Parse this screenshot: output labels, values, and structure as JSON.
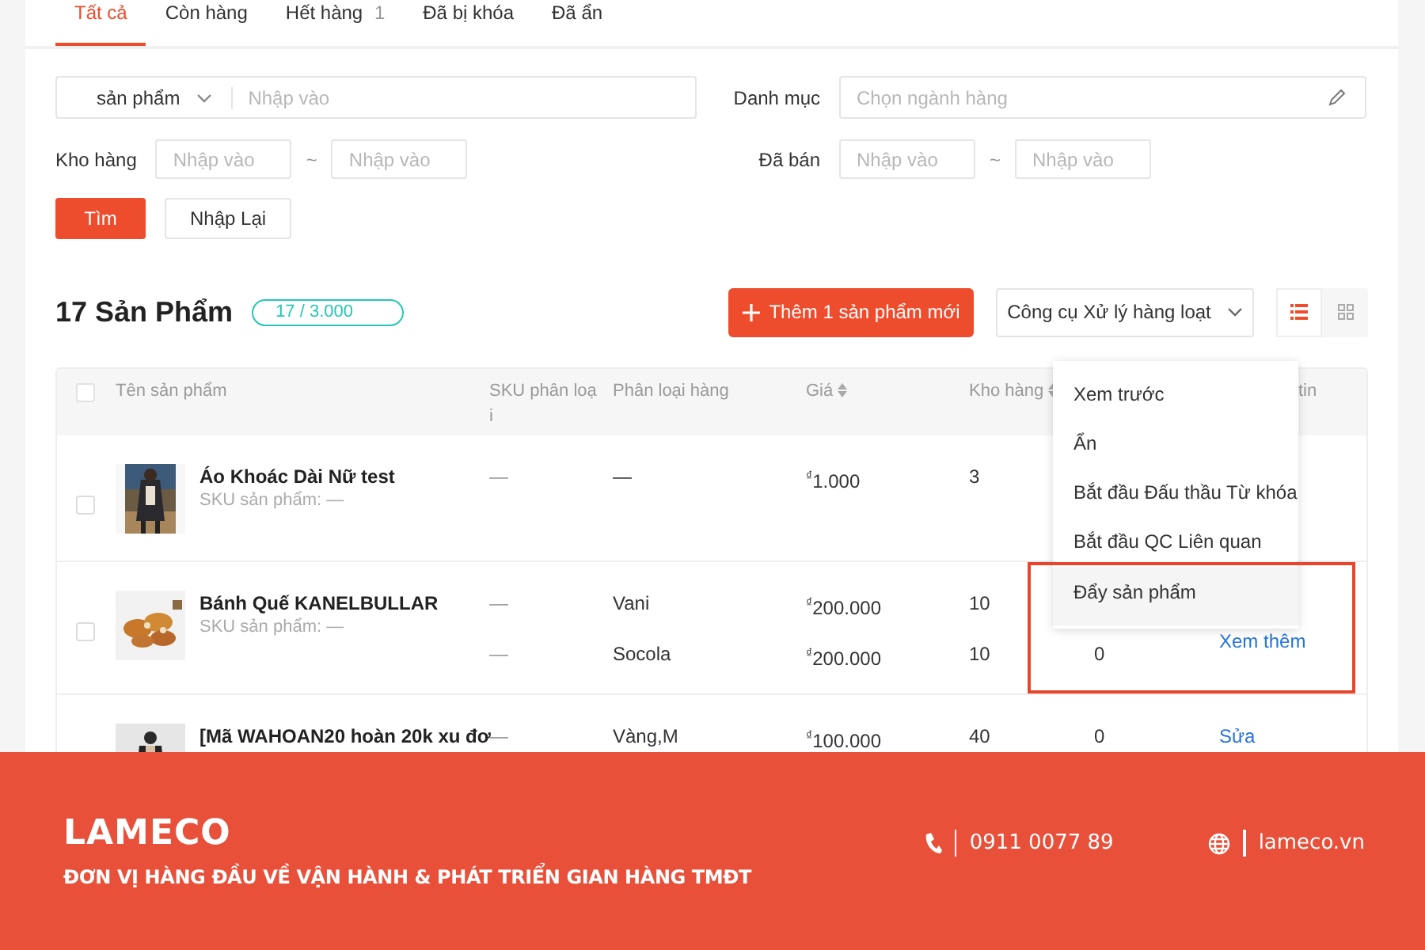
{
  "tabs": [
    {
      "label": "Tất cả",
      "selected": true
    },
    {
      "label": "Còn hàng",
      "selected": false
    },
    {
      "label": "Hết hàng",
      "count": "1",
      "selected": false
    },
    {
      "label": "Đã bị khóa",
      "selected": false
    },
    {
      "label": "Đã ẩn",
      "selected": false
    }
  ],
  "filters": {
    "product": {
      "select_label": "sản phẩm",
      "placeholder": "Nhập vào"
    },
    "category": {
      "label": "Danh mục",
      "placeholder": "Chọn ngành hàng"
    },
    "stock": {
      "label": "Kho hàng",
      "from_placeholder": "Nhập vào",
      "separator": "~",
      "to_placeholder": "Nhập vào"
    },
    "sold": {
      "label": "Đã bán",
      "from_placeholder": "Nhập vào",
      "separator": "~",
      "to_placeholder": "Nhập vào"
    },
    "search_button": "Tìm",
    "reset_button": "Nhập Lại"
  },
  "toolbar": {
    "title": "17 Sản Phẩm",
    "quota": "17 / 3.000",
    "add_button": "Thêm 1 sản phẩm mới",
    "bulk_tool": "Công cụ Xử lý hàng loạt",
    "view_modes": [
      {
        "kind": "list",
        "selected": true
      },
      {
        "kind": "grid",
        "selected": false
      }
    ]
  },
  "table": {
    "select_all_checked": false,
    "columns": [
      {
        "label": "Tên sản phẩm",
        "sortable": false
      },
      {
        "label": "SKU phân loại",
        "sortable": false
      },
      {
        "label": "Phân loại hàng",
        "sortable": false
      },
      {
        "label": "Giá",
        "sortable": true
      },
      {
        "label": "Kho hàng",
        "sortable": true
      },
      {
        "label": "tin",
        "sortable": false
      }
    ],
    "rows": [
      {
        "checked": false,
        "image": {
          "kind": "picture"
        },
        "name": "Áo Khoác Dài Nữ test",
        "sku": "SKU sản phẩm: —",
        "variants": [
          {
            "sku": "—",
            "variant": "—",
            "price": "$^{₫}$1.000",
            "stock": "3"
          }
        ]
      },
      {
        "checked": false,
        "image": {
          "kind": "picture"
        },
        "name": "Bánh Quế KANELBULLAR",
        "sku": "SKU sản phẩm: —",
        "variants": [
          {
            "sku": "—",
            "variant": "Vani",
            "price": "$^{₫}$200.000",
            "stock": "10"
          },
          {
            "sku": "—",
            "variant": "Socola",
            "price": "$^{₫}$200.000",
            "stock": "10",
            "sales": "0"
          }
        ],
        "actions": [
          "Xem thêm"
        ]
      },
      {
        "image": {
          "kind": "picture"
        },
        "name": "[Mã WAHOAN20 hoàn 20k xu đơ",
        "variants": [
          {
            "sku": "—",
            "variant": "Vàng,M",
            "price": "$^{₫}$100.000",
            "stock": "40",
            "sales": "0"
          }
        ],
        "actions": [
          "Sửa"
        ]
      }
    ]
  },
  "menu": {
    "items": [
      {
        "label": "Xem trước",
        "selected": false
      },
      {
        "label": "Ẩn",
        "selected": false
      },
      {
        "label": "Bắt đầu Đấu thầu Từ khóa",
        "selected": false
      },
      {
        "label": "Bắt đầu QC Liên quan",
        "selected": false
      },
      {
        "label": "Đẩy sản phẩm",
        "selected": true
      }
    ]
  },
  "banner": {
    "brand": "LAMECO",
    "tagline": "ĐƠN VỊ HÀNG ĐẦU VỀ VẬN HÀNH & PHÁT TRIỂN GIAN HÀNG TMĐT",
    "phone": "0911 0077 89",
    "website": "lameco.vn"
  }
}
